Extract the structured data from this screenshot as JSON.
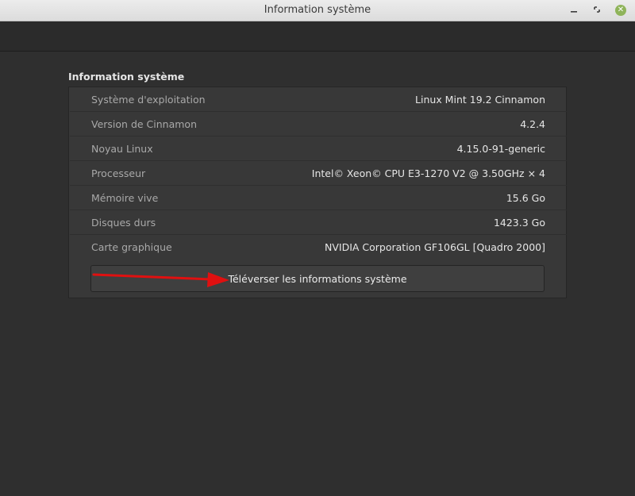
{
  "window": {
    "title": "Information système",
    "controls": {
      "minimize": "–",
      "maximize": "▪",
      "close": "✕"
    }
  },
  "section": {
    "title": "Information système"
  },
  "rows": [
    {
      "label": "Système d'exploitation",
      "value": "Linux Mint 19.2 Cinnamon"
    },
    {
      "label": "Version de Cinnamon",
      "value": "4.2.4"
    },
    {
      "label": "Noyau Linux",
      "value": "4.15.0-91-generic"
    },
    {
      "label": "Processeur",
      "value": "Intel© Xeon© CPU E3-1270 V2 @ 3.50GHz × 4"
    },
    {
      "label": "Mémoire vive",
      "value": "15.6 Go"
    },
    {
      "label": "Disques durs",
      "value": "1423.3 Go"
    },
    {
      "label": "Carte graphique",
      "value": "NVIDIA Corporation GF106GL [Quadro 2000]"
    }
  ],
  "upload_button": {
    "label": "Téléverser les informations système"
  },
  "annotation": {
    "icon": "red-arrow-icon",
    "color": "#e01010"
  },
  "colors": {
    "accent": "#8fb45a",
    "background": "#2f2f2f",
    "panel": "#383838"
  }
}
